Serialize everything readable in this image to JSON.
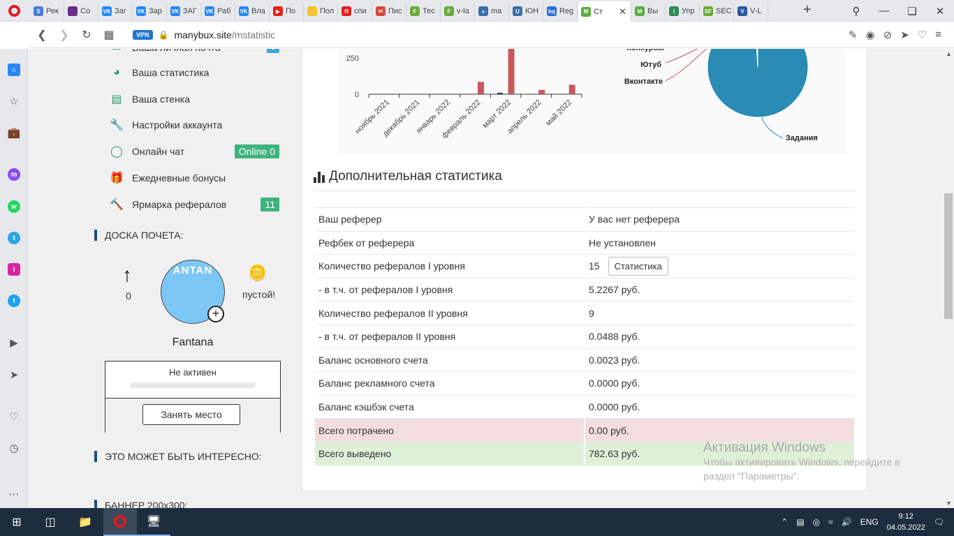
{
  "browser": {
    "tabs": [
      {
        "label": "Рек",
        "color": "#4a7bd8",
        "icon": "S"
      },
      {
        "label": "Co",
        "color": "#6b2b8a",
        "icon": ""
      },
      {
        "label": "Заг",
        "color": "#2787f5",
        "icon": "VK"
      },
      {
        "label": "Зар",
        "color": "#2787f5",
        "icon": "VK"
      },
      {
        "label": "ЗАГ",
        "color": "#2787f5",
        "icon": "VK"
      },
      {
        "label": "Раб",
        "color": "#2787f5",
        "icon": "VK"
      },
      {
        "label": "Вла",
        "color": "#2787f5",
        "icon": "VK"
      },
      {
        "label": "По",
        "color": "#e62117",
        "icon": "▶"
      },
      {
        "label": "Пол",
        "color": "#f4c430",
        "icon": ""
      },
      {
        "label": "спи",
        "color": "#e02020",
        "icon": "Я"
      },
      {
        "label": "Пис",
        "color": "#d54b3d",
        "icon": "✉"
      },
      {
        "label": "Тес",
        "color": "#6aaa3a",
        "icon": "F"
      },
      {
        "label": "v-la",
        "color": "#6aaa3a",
        "icon": "F"
      },
      {
        "label": "ma",
        "color": "#3b6fa8",
        "icon": "»"
      },
      {
        "label": "ЮН",
        "color": "#3b6fa8",
        "icon": "U"
      },
      {
        "label": "Reg",
        "color": "#2b6fd6",
        "icon": "hq"
      },
      {
        "label": "Ст",
        "color": "#5aab3f",
        "icon": "M",
        "active": true
      },
      {
        "label": "Вы",
        "color": "#5aab3f",
        "icon": "M"
      },
      {
        "label": "Упр",
        "color": "#2e8b57",
        "icon": "⋮"
      },
      {
        "label": "SEC",
        "color": "#6aaa3a",
        "icon": "SF"
      },
      {
        "label": "V-L",
        "color": "#2c5aa0",
        "icon": "V"
      }
    ],
    "vpn_label": "VPN",
    "url_host": "manybux.site",
    "url_path": "/mstatistic"
  },
  "menu": [
    {
      "label": "Ваша личная почта",
      "icon": "star-envelope-icon",
      "badge": "0"
    },
    {
      "label": "Ваша статистика",
      "icon": "pie-chart-icon",
      "badge": ""
    },
    {
      "label": "Ваша стенка",
      "icon": "id-card-icon",
      "badge": ""
    },
    {
      "label": "Настройки аккаунта",
      "icon": "wrench-icon",
      "badge": ""
    },
    {
      "label": "Онлайн чат",
      "icon": "chat-icon",
      "badge": "Online 0"
    },
    {
      "label": "Ежедневные бонусы",
      "icon": "gift-icon",
      "badge": ""
    },
    {
      "label": "Ярмарка рефералов",
      "icon": "gavel-icon",
      "badge": "11"
    }
  ],
  "honor": {
    "title": "ДОСКА ПОЧЕТА:",
    "count": "0",
    "avatar_text": "ANTAN",
    "empty": "пустой!",
    "username": "Fantana",
    "status": "Не активен",
    "button": "Занять место"
  },
  "interesting_title": "ЭТО МОЖЕТ БЫТЬ ИНТЕРЕСНО:",
  "banner_title": "БАННЕР 200x300:",
  "chart_data": [
    {
      "type": "bar",
      "categories": [
        "ноябрь 2021",
        "декабрь 2021",
        "январь 2022",
        "февраль 2022",
        "март 2022",
        "апрель 2022",
        "май 2022"
      ],
      "series": [
        {
          "values": [
            0,
            0,
            0,
            85,
            360,
            30,
            65
          ],
          "color": "#c9585c"
        },
        {
          "values": [
            0,
            0,
            0,
            0,
            10,
            0,
            0
          ],
          "color": "#2c3e50"
        }
      ],
      "ytick_labels": [
        "0",
        "250"
      ],
      "ylim": [
        0,
        360
      ]
    },
    {
      "type": "pie",
      "labels": [
        "Конкурсы",
        "Ютуб",
        "Вконтакте",
        "Задания"
      ],
      "values": [
        0.3,
        0.3,
        0.3,
        97
      ],
      "colors": [
        "#c9585c",
        "#c9585c",
        "#c9585c",
        "#2a8bb5"
      ]
    }
  ],
  "additional": {
    "title": "Дополнительная статистика",
    "button_label": "Статистика",
    "rows": [
      {
        "label": "Ваш реферер",
        "value": "У вас нет реферера"
      },
      {
        "label": "Рефбек от реферера",
        "value": "Не установлен"
      },
      {
        "label": "Количество рефералов I уровня",
        "value": "15"
      },
      {
        "label": "- в т.ч. от рефералов I уровня",
        "value": "5.2267 руб."
      },
      {
        "label": "Количество рефералов II уровня",
        "value": "9"
      },
      {
        "label": "- в т.ч. от рефералов II уровня",
        "value": "0.0488 руб."
      },
      {
        "label": "Баланс основного счета",
        "value": "0.0023 руб."
      },
      {
        "label": "Баланс рекламного счета",
        "value": "0.0000 руб."
      },
      {
        "label": "Баланс кэшбэк счета",
        "value": "0.0000 руб."
      },
      {
        "label": "Всего потрачено",
        "value": "0.00 руб."
      },
      {
        "label": "Всего выведено",
        "value": "782.63 руб."
      }
    ]
  },
  "windows": {
    "activation_title": "Активация Windows",
    "activation_line1": "Чтобы активировать Windows, перейдите в",
    "activation_line2": "раздел \"Параметры\".",
    "lang": "ENG",
    "time": "9:12",
    "date": "04.05.2022"
  }
}
